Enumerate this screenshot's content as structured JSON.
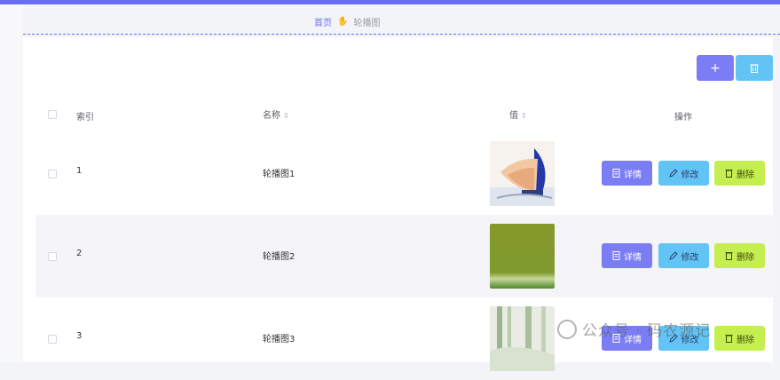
{
  "breadcrumb": {
    "home": "首页",
    "separator": "✋",
    "current": "轮播图"
  },
  "toolbar": {
    "add_icon": "+",
    "delete_icon": "🗑"
  },
  "table": {
    "headers": {
      "index": "索引",
      "name": "名称",
      "value": "值",
      "actions": "操作"
    },
    "sort_icon": "⇕",
    "rows": [
      {
        "index": "1",
        "name": "轮播图1",
        "thumb": "sailboats"
      },
      {
        "index": "2",
        "name": "轮播图2",
        "thumb": "green-grass"
      },
      {
        "index": "3",
        "name": "轮播图3",
        "thumb": "painting"
      }
    ],
    "actions": {
      "detail": "详情",
      "edit": "修改",
      "delete": "删除"
    }
  },
  "watermark": {
    "text": "公众号 · 码农源记"
  },
  "colors": {
    "accent": "#6b6df0",
    "detail": "#7b7df5",
    "edit": "#62c4f5",
    "delete": "#c5ee4f"
  }
}
